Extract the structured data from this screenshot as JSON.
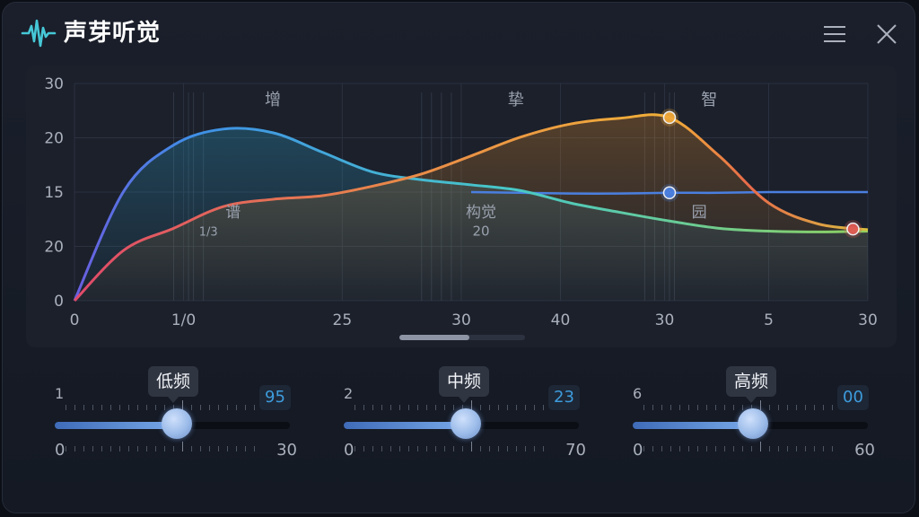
{
  "app": {
    "title": "声芽听觉"
  },
  "icons": {
    "logo": "waveform-icon",
    "menu": "hamburger-menu-icon",
    "close": "close-icon"
  },
  "colors": {
    "accent": "#3d9cdc",
    "series_blue": "#4a7fe0",
    "series_orange": "#f0a838",
    "series_red": "#e05a54",
    "series_green": "#6cc870"
  },
  "chart_data": {
    "type": "line",
    "y_tick_labels": [
      "0",
      "20",
      "15",
      "20",
      "30"
    ],
    "x_tick_labels": [
      "0",
      "1/0",
      "25",
      "30",
      "40",
      "30",
      "5",
      "30"
    ],
    "annotations": [
      "增",
      "挚",
      "智",
      "谱",
      "构觉",
      "20",
      "园",
      "1/3"
    ],
    "grid": true,
    "series": [
      {
        "color": "#4aa0e8",
        "x": [
          0,
          0.5,
          1,
          1.5,
          2,
          2.5,
          3,
          3.5,
          4,
          4.5,
          5,
          5.5,
          6,
          6.5,
          7,
          7.5,
          8
        ],
        "y": [
          0,
          15.2,
          21.5,
          23.7,
          23.2,
          20.5,
          17.8,
          16.7,
          16.0,
          15.2,
          13.5,
          12.2,
          11.0,
          10.0,
          9.6,
          9.5,
          9.6
        ]
      },
      {
        "color": "#f0a838",
        "x": [
          0,
          0.5,
          1,
          1.5,
          2,
          2.5,
          3,
          3.5,
          4,
          4.5,
          5,
          5.5,
          6,
          6.5,
          7,
          7.5,
          8
        ],
        "y": [
          0,
          7.0,
          10.0,
          13.0,
          14.0,
          14.5,
          15.8,
          17.5,
          20.0,
          22.6,
          24.4,
          25.2,
          25.3,
          20.0,
          13.5,
          10.6,
          9.8
        ]
      },
      {
        "color": "#4a7fe0",
        "x": [
          4,
          4.5,
          5,
          5.5,
          6,
          6.5,
          7,
          7.5,
          8
        ],
        "y": [
          15.0,
          14.9,
          14.8,
          14.8,
          14.9,
          14.9,
          15.0,
          15.0,
          15.0
        ]
      }
    ],
    "points": [
      {
        "x": 6.0,
        "y": 25.3,
        "color": "#f0a838"
      },
      {
        "x": 6.0,
        "y": 14.9,
        "color": "#4a7fe0"
      },
      {
        "x": 7.85,
        "y": 9.9,
        "color": "#e05a54"
      }
    ],
    "xlim": [
      0,
      8
    ],
    "ylim": [
      0,
      30
    ]
  },
  "sliders": [
    {
      "label": "低频",
      "min_top": "1",
      "value": "95",
      "min": "0",
      "max": "30",
      "level_pct": 52
    },
    {
      "label": "中频",
      "min_top": "2",
      "value": "23",
      "min": "0",
      "max": "70",
      "level_pct": 52
    },
    {
      "label": "高频",
      "min_top": "6",
      "value": "00",
      "min": "0",
      "max": "60",
      "level_pct": 51
    }
  ],
  "scrollbar": {
    "position_pct": 0,
    "visible_pct": 56
  }
}
